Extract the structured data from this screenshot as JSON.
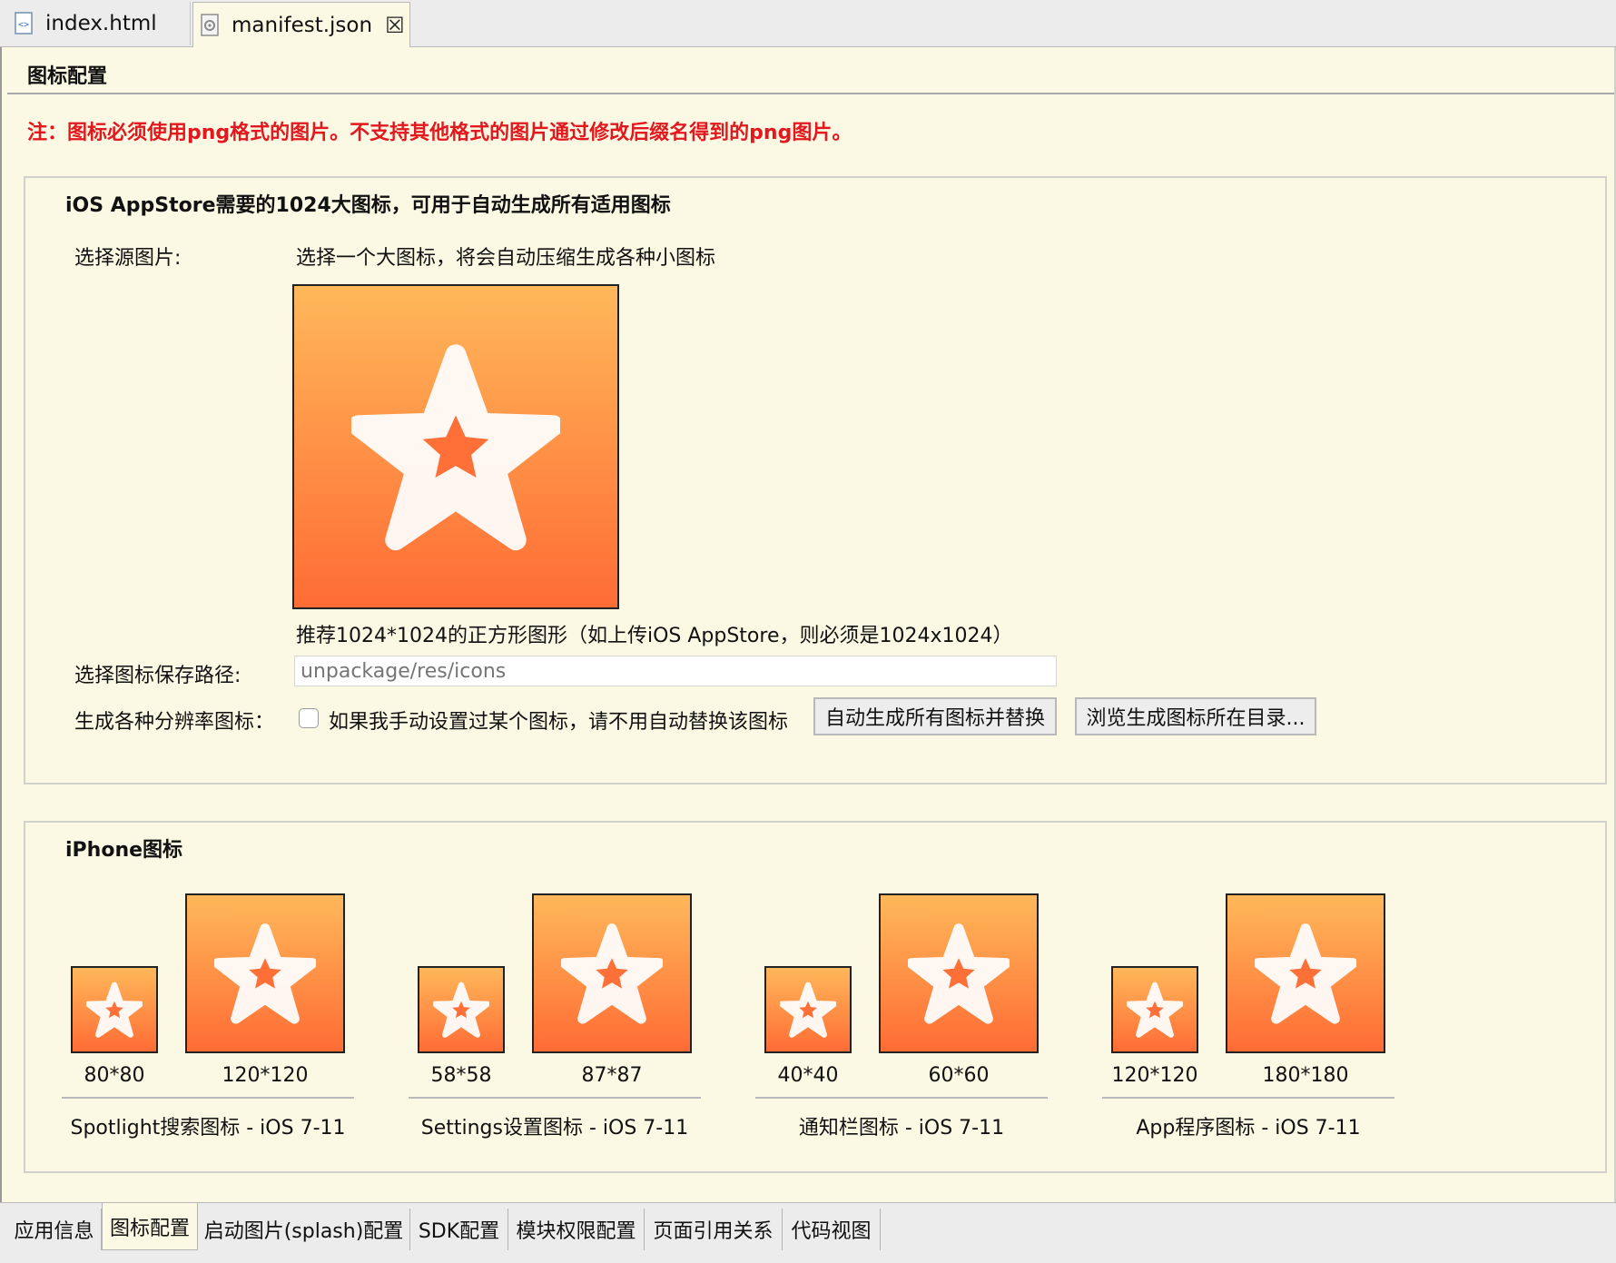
{
  "tabs": [
    {
      "label": "index.html",
      "icon": "html-file-icon"
    },
    {
      "label": "manifest.json",
      "icon": "json-file-icon",
      "close_icon": "close-icon"
    }
  ],
  "page_title": "图标配置",
  "note": "注：图标必须使用png格式的图片。不支持其他格式的图片通过修改后缀名得到的png图片。",
  "appstore": {
    "title": "iOS AppStore需要的1024大图标，可用于自动生成所有适用图标",
    "source_label": "选择源图片:",
    "source_hint": "选择一个大图标，将会自动压缩生成各种小图标",
    "recommend": "推荐1024*1024的正方形图形（如上传iOS AppStore，则必须是1024x1024）",
    "path_label": "选择图标保存路径:",
    "path_placeholder": "unpackage/res/icons",
    "path_value": "",
    "gen_label": "生成各种分辨率图标：",
    "checkbox_label": "如果我手动设置过某个图标，请不用自动替换该图标",
    "checkbox_checked": false,
    "btn_generate": "自动生成所有图标并替换",
    "btn_browse": "浏览生成图标所在目录..."
  },
  "iphone": {
    "title": "iPhone图标",
    "groups": [
      {
        "name": "Spotlight搜索图标 - iOS 7-11",
        "small": "80*80",
        "large": "120*120"
      },
      {
        "name": "Settings设置图标 - iOS 7-11",
        "small": "58*58",
        "large": "87*87"
      },
      {
        "name": "通知栏图标 - iOS 7-11",
        "small": "40*40",
        "large": "60*60"
      },
      {
        "name": "App程序图标 - iOS 7-11",
        "small": "120*120",
        "large": "180*180"
      }
    ]
  },
  "bottom_tabs": [
    "应用信息",
    "图标配置",
    "启动图片(splash)配置",
    "SDK配置",
    "模块权限配置",
    "页面引用关系",
    "代码视图"
  ],
  "active_bottom_tab": "图标配置",
  "colors": {
    "warning": "#e3171e",
    "icon_top": "#ffb85a",
    "icon_bottom": "#ff6c34",
    "editor_bg": "#fbf9e3"
  }
}
